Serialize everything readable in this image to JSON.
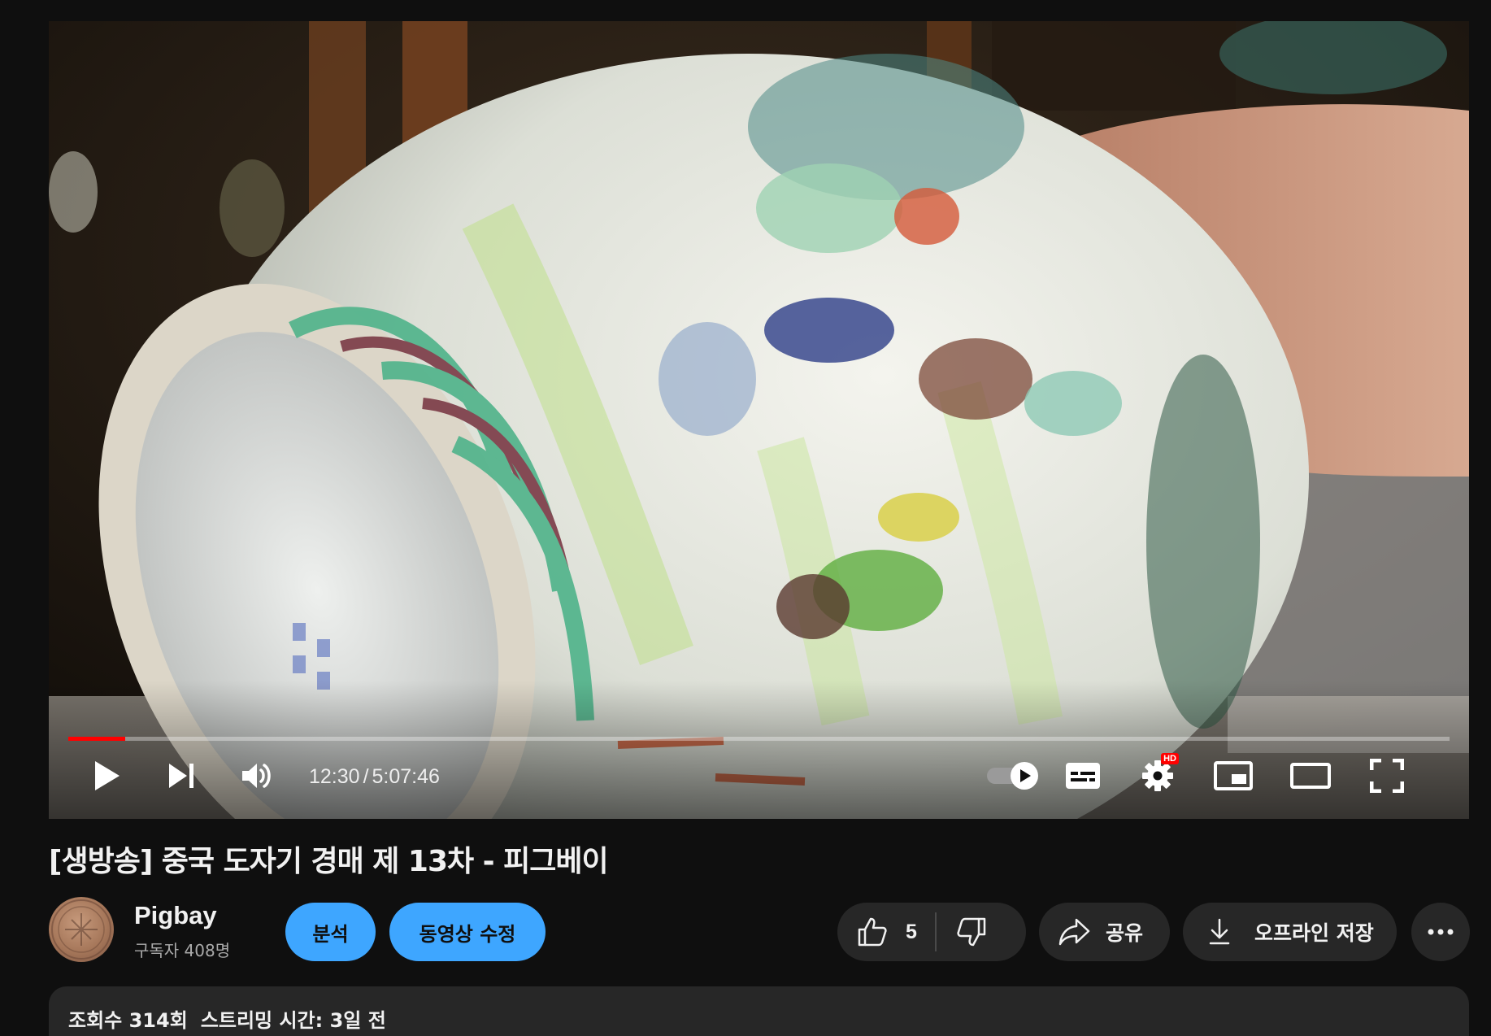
{
  "player": {
    "progress_fraction": 0.041,
    "current_time": "12:30",
    "separator": "/",
    "duration": "5:07:46",
    "hd_badge": "HD",
    "icons": {
      "play": "play-icon",
      "next": "next-icon",
      "volume": "volume-icon",
      "autoplay": "autoplay-toggle-icon",
      "subtitles": "subtitles-icon",
      "settings": "settings-gear-icon",
      "miniplayer": "miniplayer-icon",
      "theater": "theater-mode-icon",
      "fullscreen": "fullscreen-icon"
    },
    "accent": "#ff0000"
  },
  "video": {
    "title": "[생방송] 중국 도자기 경매 제 13차 - 피그베이"
  },
  "channel": {
    "name": "Pigbay",
    "subscribers": "구독자 408명"
  },
  "actions": {
    "analytics_label": "분석",
    "edit_video_label": "동영상 수정",
    "like_count": "5",
    "share_label": "공유",
    "download_label": "오프라인 저장",
    "accent": "#3ea6ff"
  },
  "description": {
    "views": "조회수 314회",
    "streamed": "스트리밍 시간: 3일 전"
  }
}
